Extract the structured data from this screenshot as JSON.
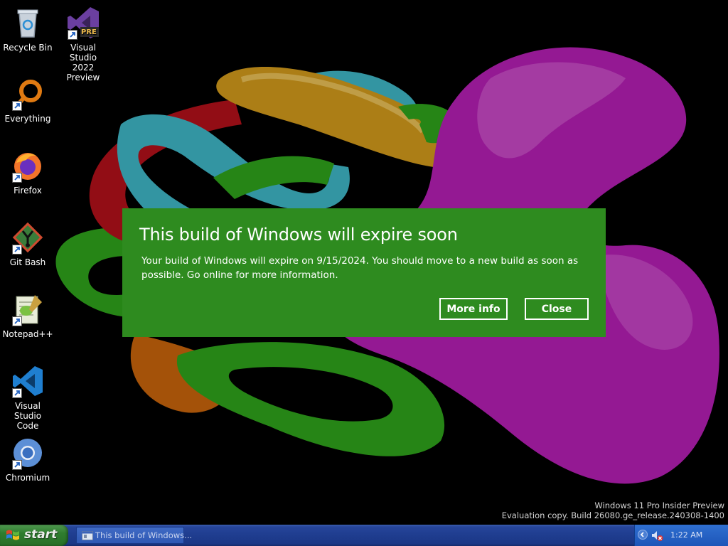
{
  "desktop": {
    "icons": [
      {
        "label": "Recycle Bin",
        "icon": "recycle-bin-icon"
      },
      {
        "label": "Visual Studio\n2022 Preview",
        "icon": "visual-studio-preview-icon",
        "badge": "PRE"
      },
      {
        "label": "Everything",
        "icon": "everything-search-icon"
      },
      {
        "label": "Firefox",
        "icon": "firefox-icon"
      },
      {
        "label": "Git Bash",
        "icon": "git-bash-icon"
      },
      {
        "label": "Notepad++",
        "icon": "notepad-plus-plus-icon"
      },
      {
        "label": "Visual Studio\nCode",
        "icon": "vscode-icon"
      },
      {
        "label": "Chromium",
        "icon": "chromium-icon"
      }
    ]
  },
  "watermark": {
    "line1": "Windows 11 Pro Insider Preview",
    "line2": "Evaluation copy. Build 26080.ge_release.240308-1400"
  },
  "dialog": {
    "title": "This build of Windows will expire soon",
    "body": "Your build of Windows will expire on 9/15/2024. You should move to a new build as soon as possible. Go online for more information.",
    "more_info_label": "More info",
    "close_label": "Close",
    "background_color": "#2e8b1f"
  },
  "taskbar": {
    "start_label": "start",
    "task_label": "This build of Windows...",
    "clock": "1:22 AM",
    "colors": {
      "bar": "#1f3d8f",
      "start": "#2f7d2f",
      "tray": "#1d55b8"
    }
  }
}
